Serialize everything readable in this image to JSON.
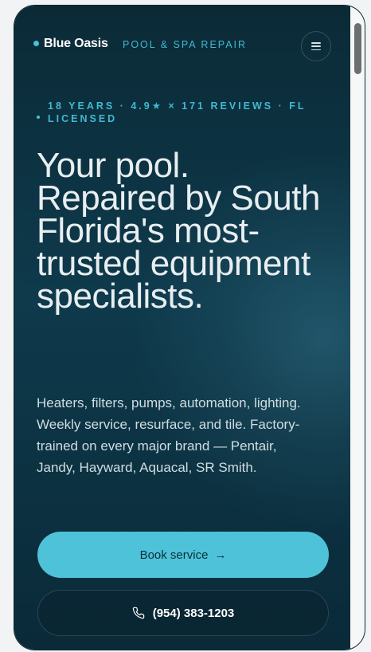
{
  "nav": {
    "brand_name": "Blue Oasis",
    "brand_tag": "POOL & SPA REPAIR",
    "menu_icon": "hamburger-icon"
  },
  "hero": {
    "eyebrow": "18 YEARS · 4.9★ × 171 REVIEWS · FL LICENSED",
    "headline": "Your pool. Repaired by South Florida's most-trusted equipment specialists.",
    "lede": "Heaters, filters, pumps, automation, lighting. Weekly service, resurface, and tile. Factory-trained on every major brand — Pentair, Jandy, Hayward, Aquacal, SR Smith."
  },
  "cta": {
    "book_label": "Book service",
    "book_icon": "arrow-right-icon",
    "phone_label": "(954) 383-1203",
    "phone_icon": "phone-icon"
  },
  "colors": {
    "background": "#0e3a4c",
    "accent": "#4ec2d8",
    "text": "#e8eef0"
  }
}
